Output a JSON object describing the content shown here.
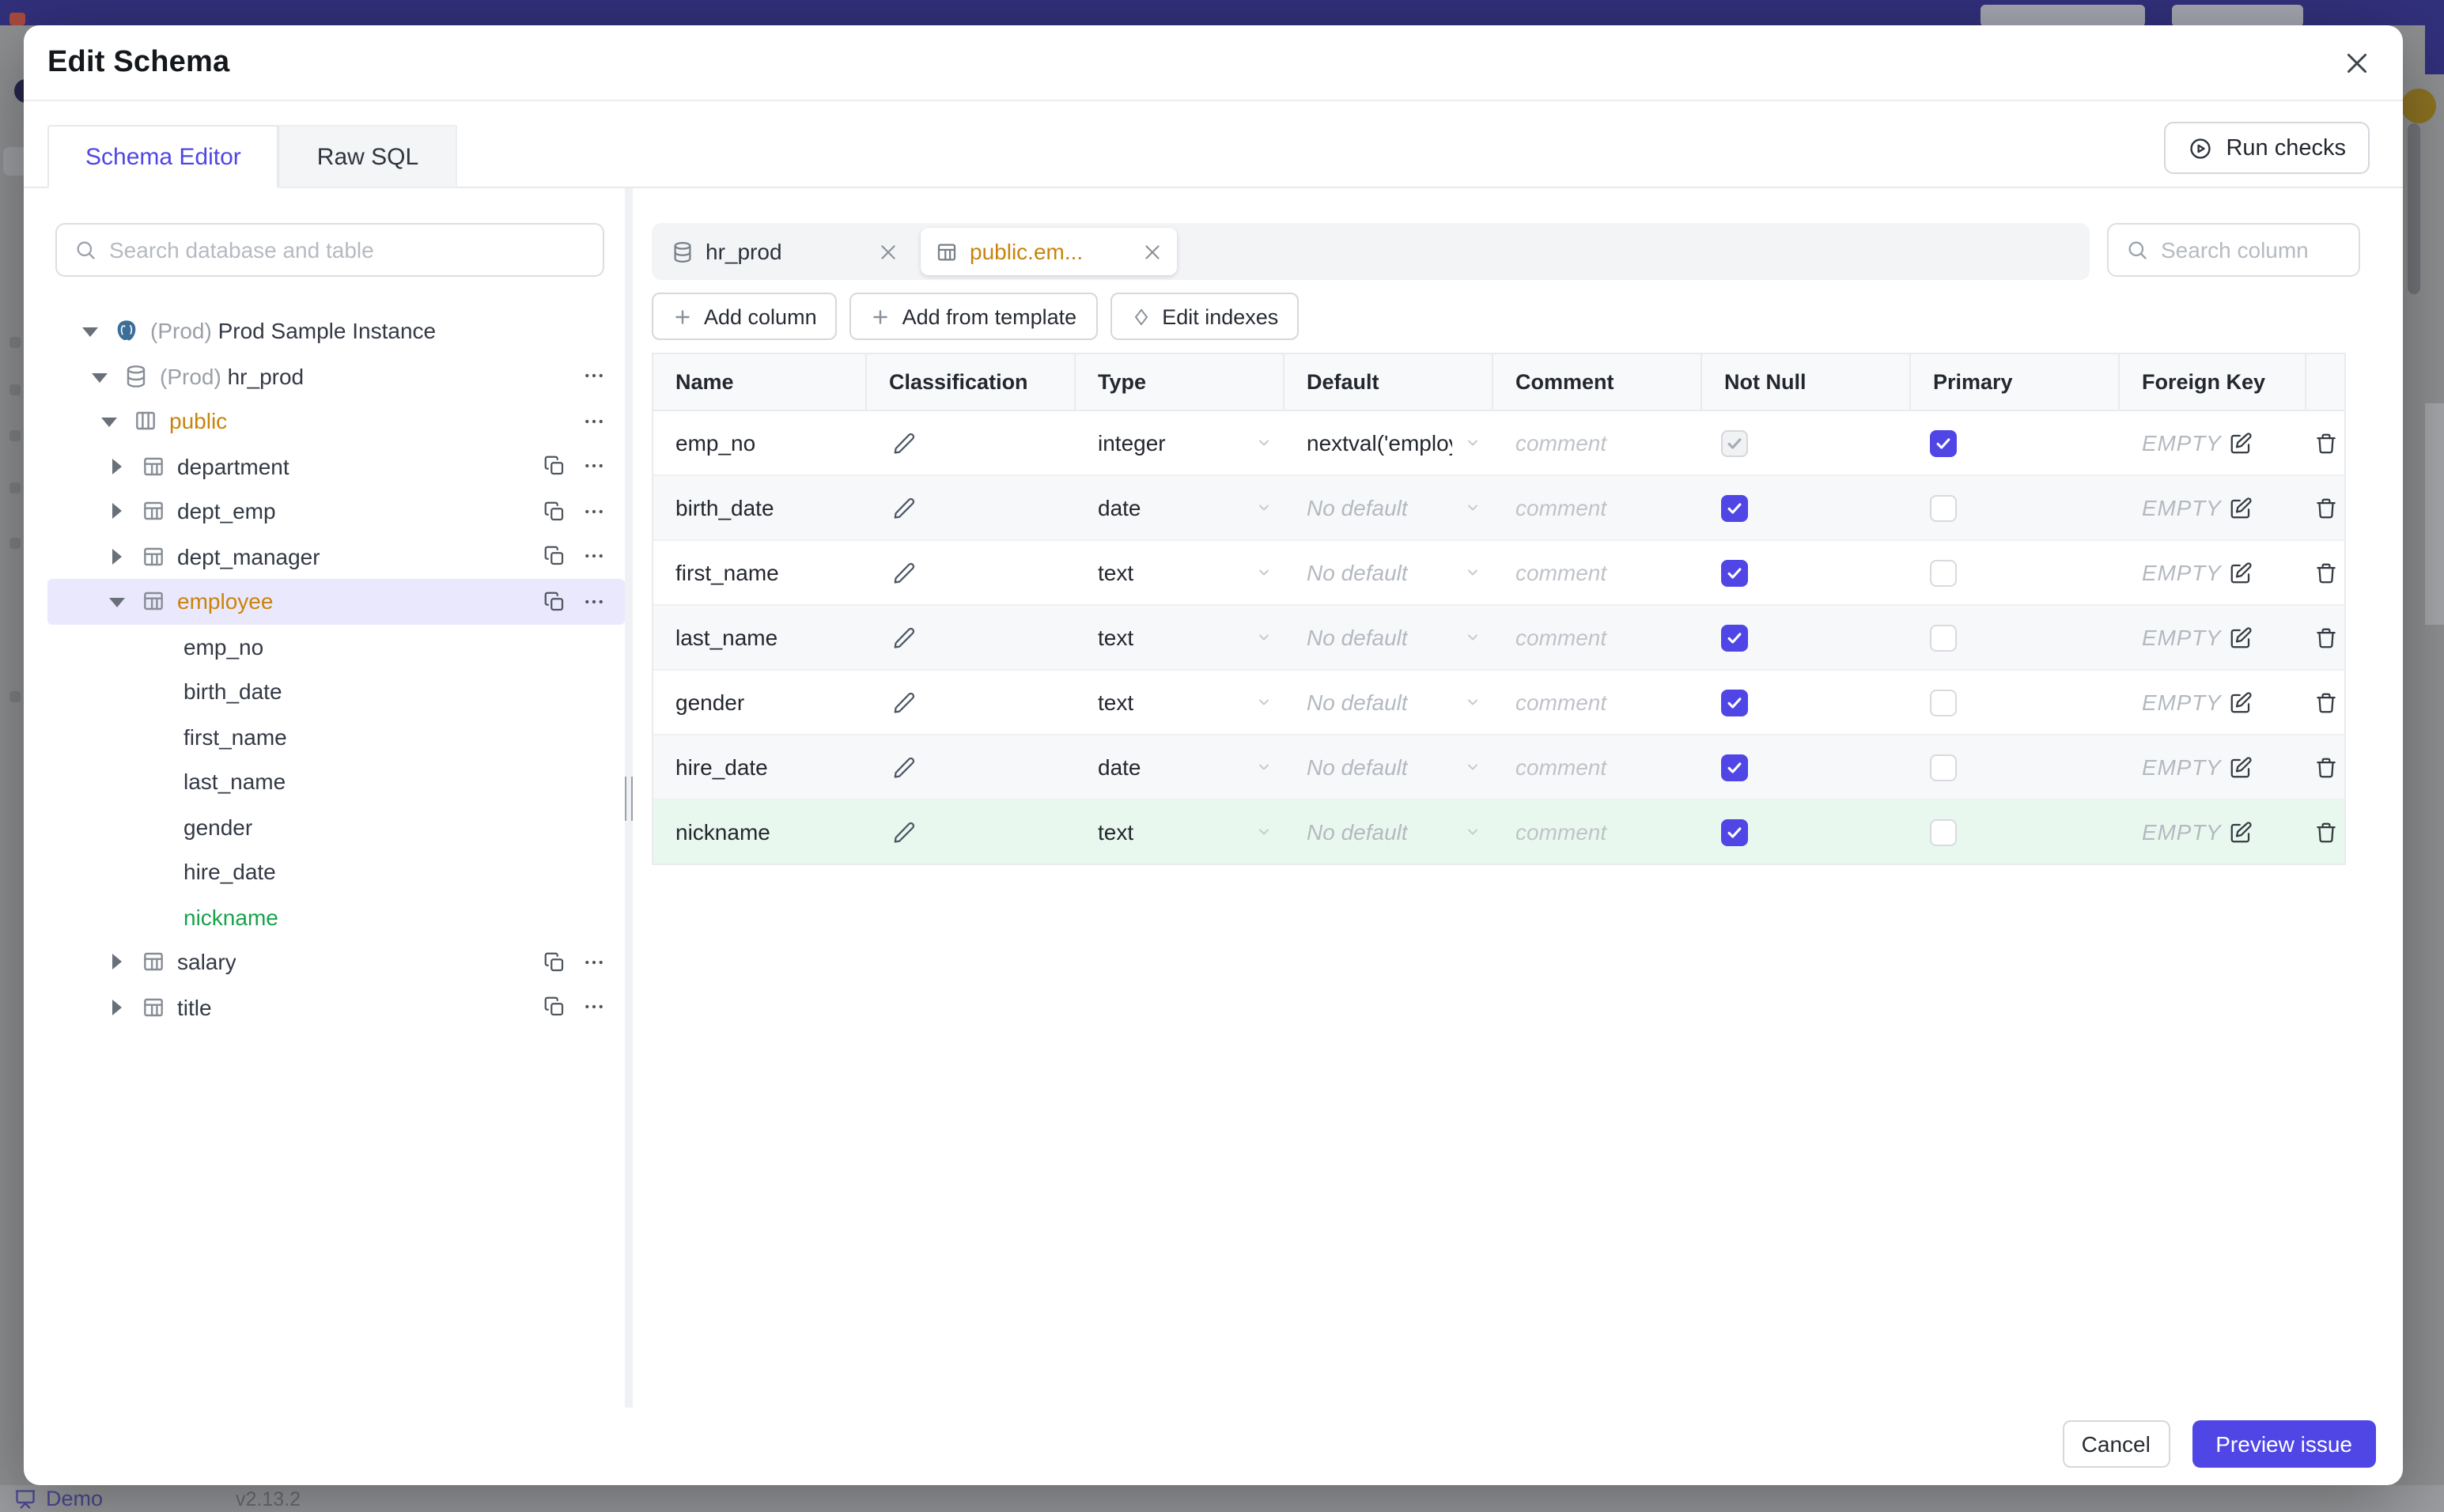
{
  "backdrop": {
    "demo_label": "Demo",
    "version": "v2.13.2"
  },
  "modal": {
    "title": "Edit Schema",
    "tabs": [
      {
        "label": "Schema Editor",
        "active": true
      },
      {
        "label": "Raw SQL",
        "active": false
      }
    ],
    "run_checks_label": "Run checks"
  },
  "sidebar": {
    "search_placeholder": "Search database and table",
    "tree": [
      {
        "label": "Prod Sample Instance",
        "prefix": "(Prod) ",
        "level": 0,
        "icon": "postgres",
        "caret": "down",
        "actions": []
      },
      {
        "label": "hr_prod",
        "prefix": "(Prod) ",
        "level": 1,
        "icon": "database",
        "caret": "down",
        "actions": [
          "kebab"
        ]
      },
      {
        "label": "public",
        "level": 2,
        "icon": "schema",
        "caret": "down",
        "color": "amber",
        "actions": [
          "kebab"
        ]
      },
      {
        "label": "department",
        "level": 3,
        "icon": "table",
        "caret": "right",
        "actions": [
          "copy",
          "kebab"
        ]
      },
      {
        "label": "dept_emp",
        "level": 3,
        "icon": "table",
        "caret": "right",
        "actions": [
          "copy",
          "kebab"
        ]
      },
      {
        "label": "dept_manager",
        "level": 3,
        "icon": "table",
        "caret": "right",
        "actions": [
          "copy",
          "kebab"
        ]
      },
      {
        "label": "employee",
        "level": 3,
        "icon": "table",
        "caret": "down",
        "color": "amber",
        "selected": true,
        "actions": [
          "copy",
          "kebab"
        ]
      },
      {
        "label": "emp_no",
        "level": 4
      },
      {
        "label": "birth_date",
        "level": 4
      },
      {
        "label": "first_name",
        "level": 4
      },
      {
        "label": "last_name",
        "level": 4
      },
      {
        "label": "gender",
        "level": 4
      },
      {
        "label": "hire_date",
        "level": 4
      },
      {
        "label": "nickname",
        "level": 4,
        "color": "green"
      },
      {
        "label": "salary",
        "level": 3,
        "icon": "table",
        "caret": "right",
        "actions": [
          "copy",
          "kebab"
        ]
      },
      {
        "label": "title",
        "level": 3,
        "icon": "table",
        "caret": "right",
        "actions": [
          "copy",
          "kebab"
        ]
      }
    ]
  },
  "editor": {
    "tabs": [
      {
        "label": "hr_prod",
        "icon": "database",
        "active": false
      },
      {
        "label": "public.em...",
        "icon": "table",
        "active": true
      }
    ],
    "search_placeholder": "Search column",
    "toolbar": [
      {
        "label": "Add column",
        "icon": "plus"
      },
      {
        "label": "Add from template",
        "icon": "plus"
      },
      {
        "label": "Edit indexes",
        "icon": "diamond"
      }
    ],
    "table": {
      "columns": [
        "Name",
        "Classification",
        "Type",
        "Default",
        "Comment",
        "Not Null",
        "Primary",
        "Foreign Key",
        ""
      ],
      "comment_placeholder": "comment",
      "foreign_key_empty": "EMPTY",
      "rows": [
        {
          "name": "emp_no",
          "type": "integer",
          "default": "nextval('employ",
          "default_is_value": true,
          "not_null": "checked-disabled",
          "primary": "checked",
          "highlight": false
        },
        {
          "name": "birth_date",
          "type": "date",
          "default": "No default",
          "default_is_value": false,
          "not_null": "checked",
          "primary": "unchecked",
          "highlight": false
        },
        {
          "name": "first_name",
          "type": "text",
          "default": "No default",
          "default_is_value": false,
          "not_null": "checked",
          "primary": "unchecked",
          "highlight": false
        },
        {
          "name": "last_name",
          "type": "text",
          "default": "No default",
          "default_is_value": false,
          "not_null": "checked",
          "primary": "unchecked",
          "highlight": false
        },
        {
          "name": "gender",
          "type": "text",
          "default": "No default",
          "default_is_value": false,
          "not_null": "checked",
          "primary": "unchecked",
          "highlight": false
        },
        {
          "name": "hire_date",
          "type": "date",
          "default": "No default",
          "default_is_value": false,
          "not_null": "checked",
          "primary": "unchecked",
          "highlight": false
        },
        {
          "name": "nickname",
          "type": "text",
          "default": "No default",
          "default_is_value": false,
          "not_null": "checked",
          "primary": "unchecked",
          "highlight": true
        }
      ]
    }
  },
  "footer": {
    "cancel_label": "Cancel",
    "submit_label": "Preview issue"
  },
  "colors": {
    "accent": "#4f46e5",
    "amber": "#c9830c",
    "green": "#16a34a",
    "topbar": "#31307b",
    "new_row_bg": "#e9f8ef",
    "selected_tree_bg": "#eae8fc"
  }
}
